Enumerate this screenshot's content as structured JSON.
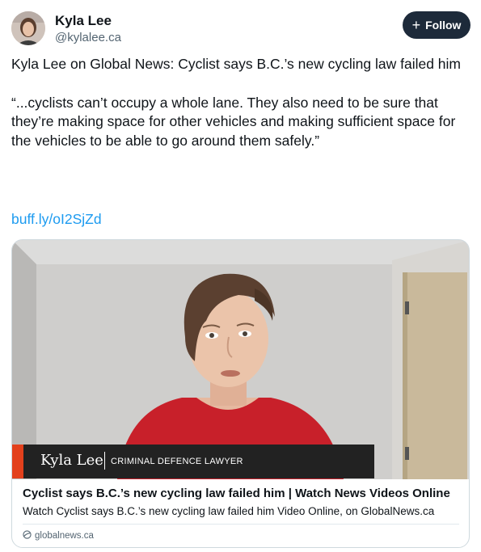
{
  "author": {
    "name": "Kyla Lee",
    "handle": "@kylalee.ca"
  },
  "follow": {
    "icon": "plus-icon",
    "label": "Follow"
  },
  "post": {
    "headline": "Kyla Lee on Global News: Cyclist says B.C.’s new cycling law failed him",
    "quote": "“...cyclists can’t occupy a whole lane. They also need to be sure that they’re making space for other vehicles and making sufficient space for the vehicles to be able to go around them safely.”",
    "link": "buff.ly/oI2SjZd"
  },
  "card": {
    "lower_third": {
      "name": "Kyla Lee",
      "role": "CRIMINAL DEFENCE LAWYER"
    },
    "title": "Cyclist says B.C.’s new cycling law failed him | Watch News Videos Online",
    "description": "Watch Cyclist says B.C.’s new cycling law failed him Video Online, on GlobalNews.ca",
    "domain": "globalnews.ca"
  },
  "colors": {
    "link": "#1d9bf0",
    "follow_bg": "#1d2a3a",
    "lower_third_accent": "#e3401c"
  }
}
